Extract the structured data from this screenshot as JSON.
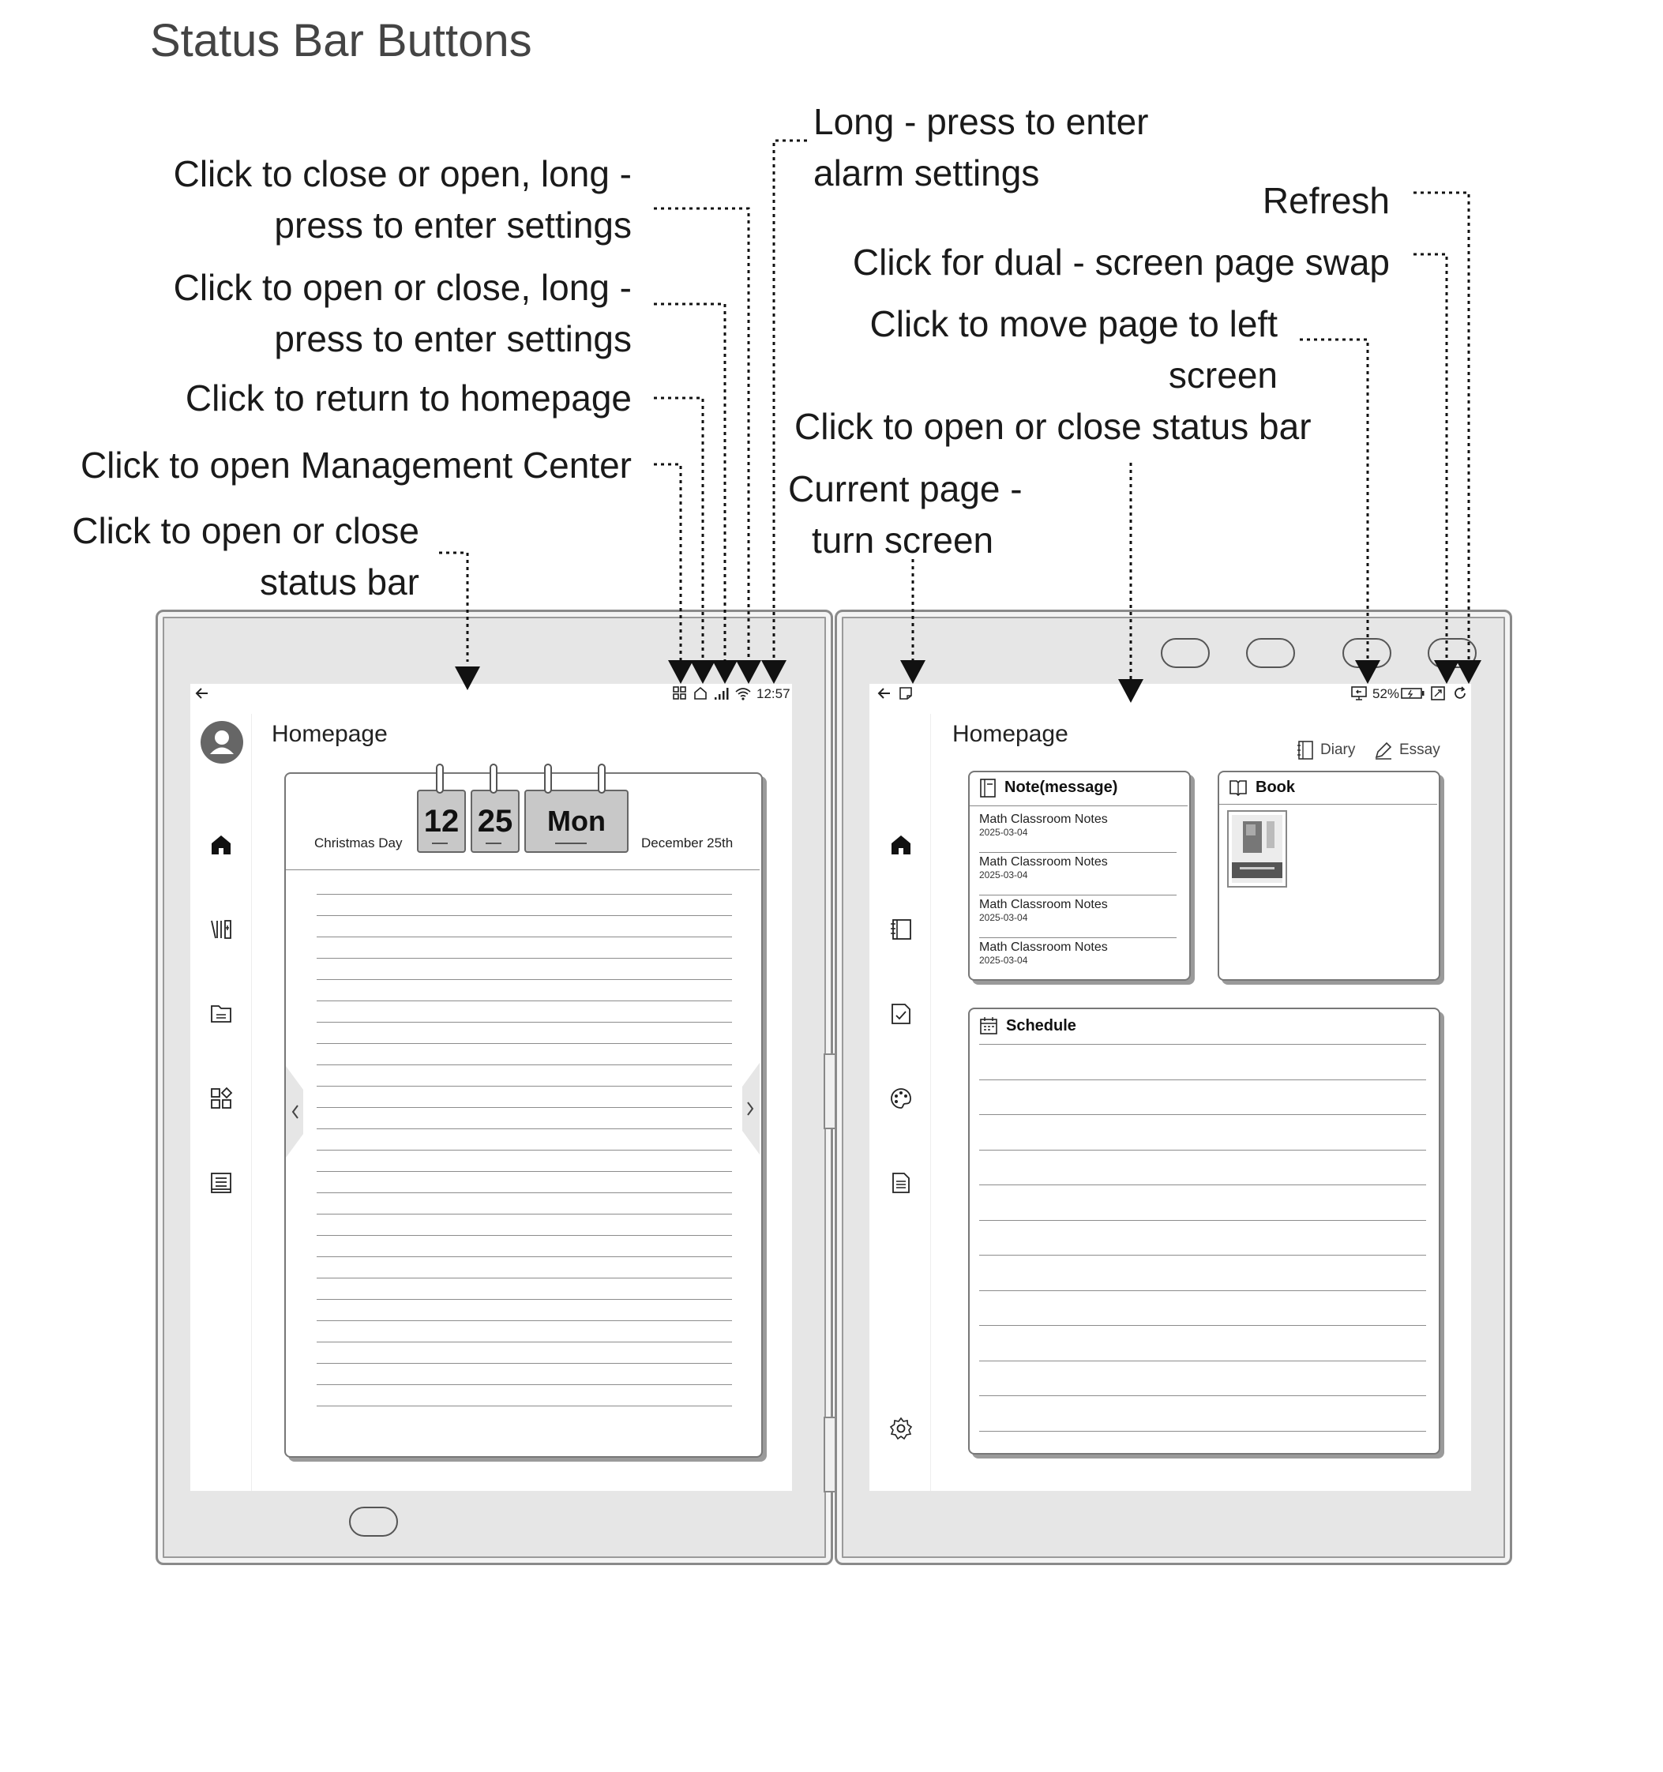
{
  "page_title": "Status Bar Buttons",
  "callouts": {
    "left_wifi": [
      "Click to close or open, long -",
      "press to enter settings"
    ],
    "left_signal": [
      "Click to open or close, long -",
      "press to enter settings"
    ],
    "left_home": "Click to return to homepage",
    "left_management": "Click to open Management Center",
    "left_statusbar": [
      "Click to open or close",
      "status bar"
    ],
    "top_alarm": [
      "Long - press to enter",
      "alarm settings"
    ],
    "right_refresh": "Refresh",
    "right_swap": "Click for dual - screen page swap",
    "right_move": [
      "Click to move page to left",
      "screen"
    ],
    "right_statusbar": "Click to open or close status bar",
    "right_current": [
      "Current page -",
      "turn screen"
    ]
  },
  "left_screen": {
    "status_time": "12:57",
    "page_title": "Homepage",
    "calendar": {
      "holiday": "Christmas Day",
      "month": "12",
      "day": "25",
      "weekday": "Mon",
      "date_text": "December 25th"
    },
    "sidebar_icons": [
      "avatar",
      "home-icon",
      "library-icon",
      "folder-icon",
      "apps-icon",
      "notes-icon"
    ]
  },
  "right_screen": {
    "battery": "52%",
    "page_title": "Homepage",
    "actions": {
      "diary": "Diary",
      "essay": "Essay"
    },
    "note_card": {
      "title": "Note(message)",
      "items": [
        {
          "title": "Math Classroom Notes",
          "date": "2025-03-04"
        },
        {
          "title": "Math Classroom Notes",
          "date": "2025-03-04"
        },
        {
          "title": "Math Classroom Notes",
          "date": "2025-03-04"
        },
        {
          "title": "Math Classroom Notes",
          "date": "2025-03-04"
        }
      ]
    },
    "book_card": {
      "title": "Book"
    },
    "schedule_card": {
      "title": "Schedule"
    },
    "sidebar_icons": [
      "home-icon",
      "notebook-icon",
      "task-icon",
      "palette-icon",
      "document-icon",
      "settings-icon"
    ]
  },
  "colors": {
    "device": "#e6e6e6",
    "screen": "#ffffff",
    "tile": "#c8c8c8",
    "ink": "#111111"
  }
}
